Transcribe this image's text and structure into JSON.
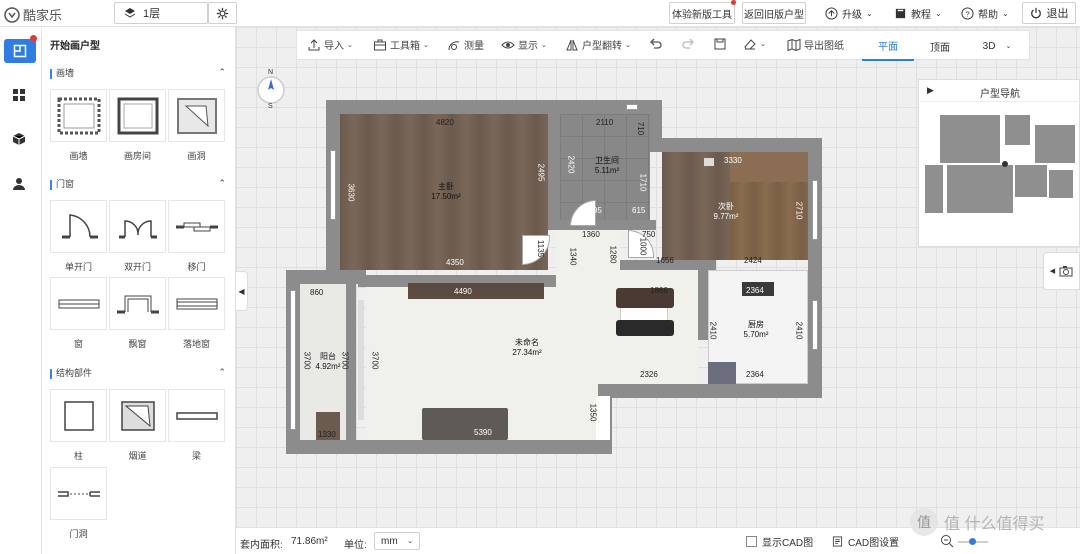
{
  "app": {
    "logo_text": "酷家乐"
  },
  "topbar": {
    "floor_selector": "1层",
    "try_new_label": "体验新版工具",
    "return_old_label": "返回旧版户型",
    "upgrade_label": "升级",
    "tutorial_label": "教程",
    "help_label": "帮助",
    "exit_label": "退出"
  },
  "panel": {
    "title": "开始画户型",
    "sections": [
      {
        "title": "画墙",
        "items": [
          "画墙",
          "画房间",
          "画洞"
        ]
      },
      {
        "title": "门窗",
        "items": [
          "单开门",
          "双开门",
          "移门",
          "窗",
          "飘窗",
          "落地窗"
        ]
      },
      {
        "title": "结构部件",
        "items": [
          "柱",
          "烟道",
          "梁",
          "门洞"
        ]
      }
    ]
  },
  "toolbar": {
    "items": [
      "导入",
      "工具箱",
      "测量",
      "显示",
      "户型翻转",
      "导出图纸"
    ],
    "views": [
      "平面",
      "顶面",
      "3D"
    ],
    "active_view": "平面"
  },
  "compass": {
    "north": "N",
    "south": "S"
  },
  "navigator": {
    "title": "户型导航"
  },
  "floorplan": {
    "rooms": [
      {
        "name": "主卧",
        "area": "17.50m²"
      },
      {
        "name": "卫生间",
        "area": "5.11m²"
      },
      {
        "name": "次卧",
        "area": "9.77m²"
      },
      {
        "name": "未命名",
        "area": "27.34m²"
      },
      {
        "name": "阳台",
        "area": "4.92m²"
      },
      {
        "name": "厨房",
        "area": "5.70m²"
      }
    ],
    "dimensions": [
      "4820",
      "2110",
      "710",
      "3330",
      "2420",
      "2495",
      "3630",
      "1710",
      "2710",
      "1495",
      "615",
      "750",
      "1360",
      "1135",
      "1280",
      "1000",
      "1340",
      "4350",
      "1656",
      "2424",
      "860",
      "4490",
      "1866",
      "2364",
      "3700",
      "3700",
      "3700",
      "2410",
      "2410",
      "2326",
      "2364",
      "1350",
      "1330",
      "5390"
    ]
  },
  "statusbar": {
    "area_label": "套内面积:",
    "area_value": "71.86m²",
    "unit_label": "单位:",
    "unit_value": "mm",
    "cad_show_label": "显示CAD图",
    "cad_settings_label": "CAD图设置"
  },
  "watermark": {
    "text": "值 什么值得买"
  },
  "colors": {
    "accent": "#2f7de1",
    "badge": "#e53935",
    "wall": "#8c8c8c"
  }
}
